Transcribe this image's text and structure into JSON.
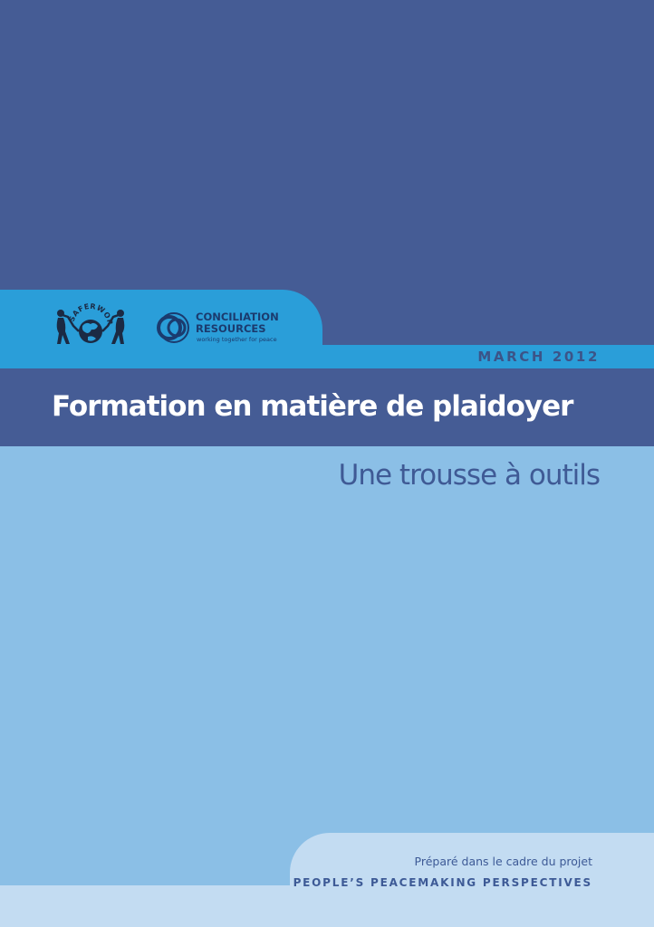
{
  "logos": {
    "saferworld": {
      "wordmark": "SAFERWORLD"
    },
    "conciliation_resources": {
      "name_line1": "CONCILIATION",
      "name_line2": "RESOURCES",
      "tagline": "working together for peace"
    }
  },
  "date": "MARCH 2012",
  "title": "Formation en matière de plaidoyer",
  "subtitle": "Une trousse à outils",
  "footer": {
    "line1": "Préparé dans le cadre du projet",
    "line2": "PEOPLE’S PEACEMAKING PERSPECTIVES"
  },
  "colors": {
    "dark_blue": "#455c95",
    "bright_blue": "#2a9ed9",
    "light_blue": "#8bbfe6",
    "pale_blue": "#c3dcf2",
    "text_dark": "#1b3b6e"
  }
}
